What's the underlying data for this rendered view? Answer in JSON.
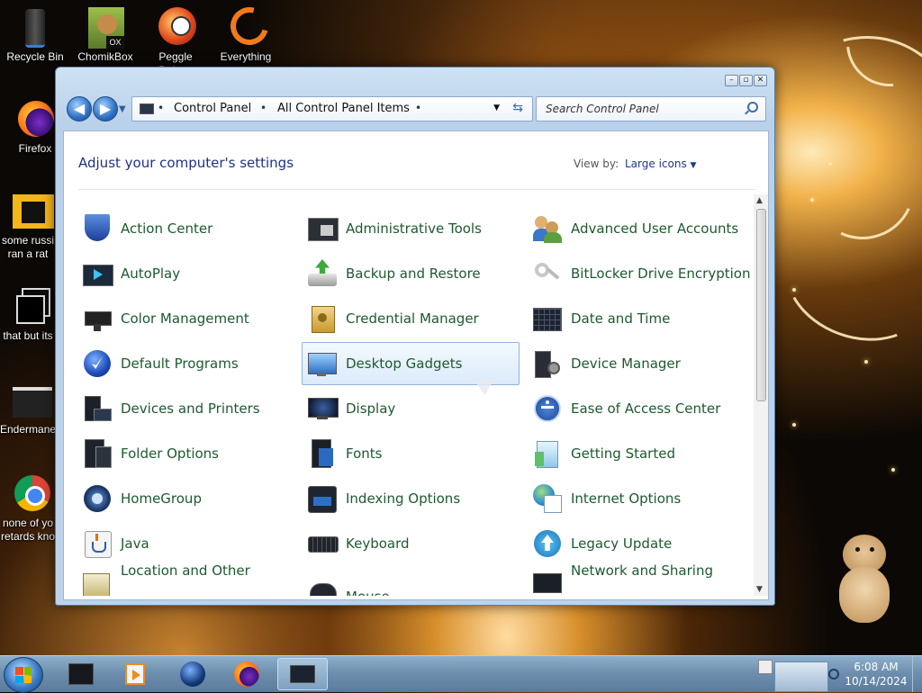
{
  "desktop": {
    "icons": [
      {
        "label": "Recycle Bin",
        "icon": "recycle-bin-icon"
      },
      {
        "label": "ChomikBox",
        "icon": "chomikbox-icon"
      },
      {
        "label": "Peggle Deluxe",
        "icon": "peggle-icon"
      },
      {
        "label": "Everything",
        "icon": "everything-icon"
      },
      {
        "label": "Firefox",
        "icon": "firefox-icon"
      },
      {
        "label": "some russi ran a rat",
        "icon": "folder-icon"
      },
      {
        "label": "that but its",
        "icon": "shortcut-icon"
      },
      {
        "label": "Endermane",
        "icon": "program-icon"
      },
      {
        "label": "none of yo retards kno",
        "icon": "chrome-icon"
      }
    ]
  },
  "window": {
    "address": {
      "crumbs": [
        "Control Panel",
        "All Control Panel Items"
      ]
    },
    "search": {
      "placeholder": "Search Control Panel"
    },
    "heading": "Adjust your computer's settings",
    "view_by_label": "View by:",
    "view_by_value": "Large icons",
    "items": [
      {
        "label": "Action Center",
        "icon": "shield-flag-icon"
      },
      {
        "label": "Administrative Tools",
        "icon": "admin-tools-icon"
      },
      {
        "label": "Advanced User Accounts",
        "icon": "users-icon"
      },
      {
        "label": "AutoPlay",
        "icon": "autoplay-icon"
      },
      {
        "label": "Backup and Restore",
        "icon": "backup-icon"
      },
      {
        "label": "BitLocker Drive Encryption",
        "icon": "bitlocker-key-icon"
      },
      {
        "label": "Color Management",
        "icon": "color-management-icon"
      },
      {
        "label": "Credential Manager",
        "icon": "credential-vault-icon"
      },
      {
        "label": "Date and Time",
        "icon": "calendar-clock-icon"
      },
      {
        "label": "Default Programs",
        "icon": "default-programs-icon"
      },
      {
        "label": "Desktop Gadgets",
        "icon": "desktop-gadgets-icon"
      },
      {
        "label": "Device Manager",
        "icon": "device-manager-icon"
      },
      {
        "label": "Devices and Printers",
        "icon": "printer-icon"
      },
      {
        "label": "Display",
        "icon": "display-icon"
      },
      {
        "label": "Ease of Access Center",
        "icon": "ease-of-access-icon"
      },
      {
        "label": "Folder Options",
        "icon": "folder-options-icon"
      },
      {
        "label": "Fonts",
        "icon": "fonts-icon"
      },
      {
        "label": "Getting Started",
        "icon": "getting-started-icon"
      },
      {
        "label": "HomeGroup",
        "icon": "homegroup-icon"
      },
      {
        "label": "Indexing Options",
        "icon": "indexing-icon"
      },
      {
        "label": "Internet Options",
        "icon": "internet-options-icon"
      },
      {
        "label": "Java",
        "icon": "java-icon"
      },
      {
        "label": "Keyboard",
        "icon": "keyboard-icon"
      },
      {
        "label": "Legacy Update",
        "icon": "update-arrow-icon"
      },
      {
        "label": "Location and Other",
        "icon": "location-icon"
      },
      {
        "label": "Mouse",
        "icon": "mouse-icon"
      },
      {
        "label": "Network and Sharing",
        "icon": "network-icon"
      }
    ],
    "selected_item": "Desktop Gadgets"
  },
  "taskbar": {
    "time": "6:08 AM",
    "date": "10/14/2024"
  },
  "colors": {
    "item_text": "#1d5a2f",
    "heading": "#1e3287",
    "link": "#1e3a8c"
  }
}
